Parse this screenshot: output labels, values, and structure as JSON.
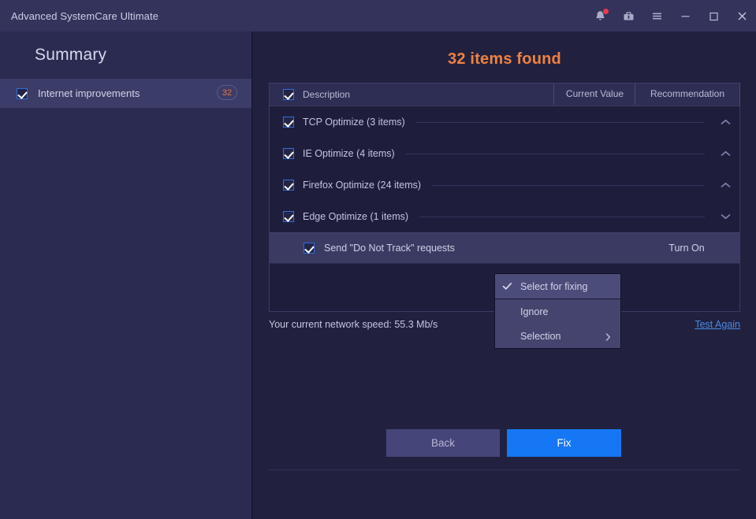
{
  "window": {
    "title": "Advanced SystemCare Ultimate",
    "controls": [
      {
        "name": "notifications-bell-icon",
        "label": "Notifications"
      },
      {
        "name": "toolbox-icon",
        "label": "Toolbox"
      },
      {
        "name": "menu-icon",
        "label": "Menu"
      },
      {
        "name": "minimize-icon",
        "label": "Minimize"
      },
      {
        "name": "maximize-icon",
        "label": "Maximize"
      },
      {
        "name": "close-icon",
        "label": "Close"
      }
    ]
  },
  "sidebar": {
    "title": "Summary",
    "item": {
      "label": "Internet improvements",
      "badge": "32"
    }
  },
  "main": {
    "heading": "32 items found",
    "table": {
      "columns": {
        "description": "Description",
        "current_value": "Current Value",
        "recommendation": "Recommendation"
      },
      "groups": [
        {
          "label": "TCP Optimize (3 items)",
          "chevron": "chevron-up-icon",
          "checked": true
        },
        {
          "label": "IE Optimize (4 items)",
          "chevron": "chevron-up-icon",
          "checked": true
        },
        {
          "label": "Firefox Optimize (24 items)",
          "chevron": "chevron-up-icon",
          "checked": true
        },
        {
          "label": "Edge Optimize (1 items)",
          "chevron": "chevron-down-icon",
          "checked": true
        }
      ],
      "leaf_row": {
        "label": "Send \"Do Not Track\" requests",
        "current_value": "",
        "recommendation": "Turn On",
        "checked": true
      }
    },
    "context_menu": [
      {
        "label": "Select for fixing",
        "checked": true,
        "submenu": false
      },
      {
        "label": "Ignore",
        "checked": false,
        "submenu": false
      },
      {
        "label": "Selection",
        "checked": false,
        "submenu": true
      }
    ],
    "network_speed": "Your current network speed: 55.3 Mb/s",
    "test_again": "Test Again",
    "buttons": {
      "back": "Back",
      "fix": "Fix"
    }
  },
  "colors": {
    "accent_orange": "#f0813f",
    "primary_blue": "#1677f5",
    "link_blue": "#4a8ae8",
    "titlebar": "#33335c",
    "sidebar": "#2b2b52",
    "main_bg": "#21213f",
    "notification_dot": "#ea3b4b"
  }
}
